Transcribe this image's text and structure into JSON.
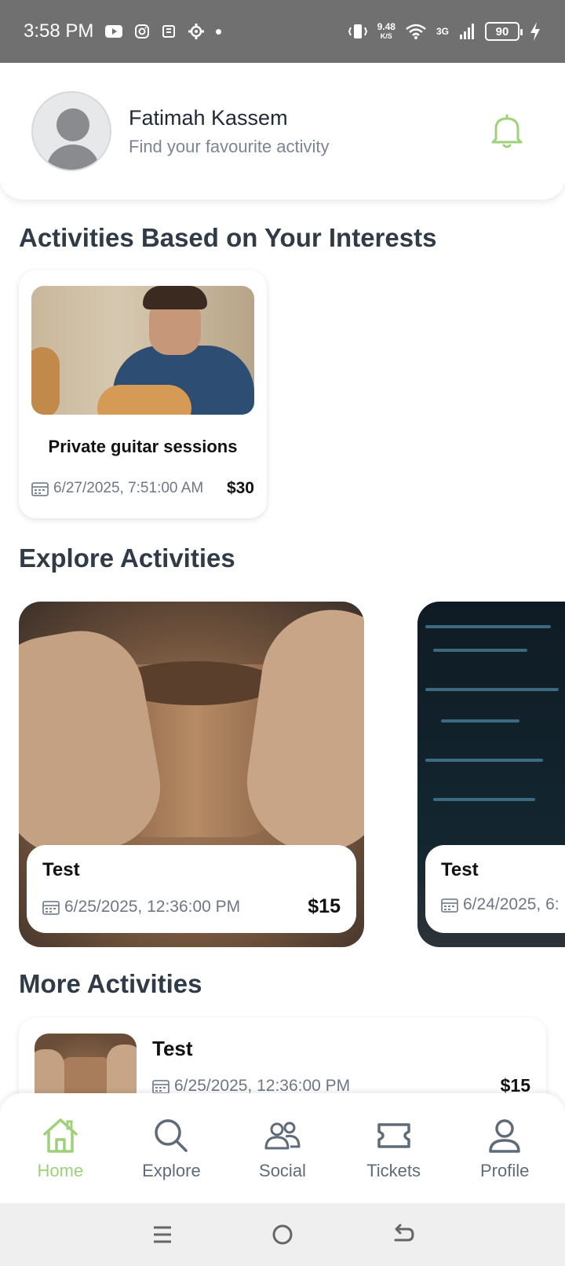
{
  "status_bar": {
    "time": "3:58 PM",
    "net_speed_value": "9.48",
    "net_speed_unit": "K/S",
    "network": "3G",
    "battery": "90"
  },
  "header": {
    "name": "Fatimah Kassem",
    "subtitle": "Find your favourite activity"
  },
  "sections": {
    "interests_title": "Activities Based on Your Interests",
    "explore_title": "Explore Activities",
    "more_title": "More Activities"
  },
  "interest_card": {
    "title": "Private guitar sessions",
    "date": "6/27/2025, 7:51:00 AM",
    "price": "$30"
  },
  "explore_cards": [
    {
      "title": "Test",
      "date": "6/25/2025, 12:36:00 PM",
      "price": "$15"
    },
    {
      "title": "Test",
      "date": "6/24/2025, 6:",
      "price": ""
    }
  ],
  "more_card": {
    "title": "Test",
    "date": "6/25/2025, 12:36:00 PM",
    "price": "$15"
  },
  "bottom_nav": [
    {
      "label": "Home",
      "active": true
    },
    {
      "label": "Explore",
      "active": false
    },
    {
      "label": "Social",
      "active": false
    },
    {
      "label": "Tickets",
      "active": false
    },
    {
      "label": "Profile",
      "active": false
    }
  ],
  "colors": {
    "accent_green": "#9ed179",
    "status_bar_bg": "#707070",
    "text_dark": "#2f3b47",
    "text_muted": "#6e7785"
  }
}
